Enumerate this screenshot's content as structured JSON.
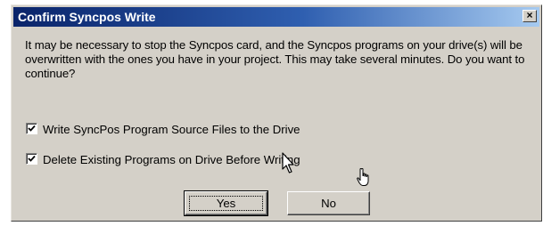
{
  "window": {
    "title": "Confirm Syncpos Write",
    "close_label": "×"
  },
  "message": "It may be necessary to stop the Syncpos card, and the Syncpos programs on your drive(s) will be overwritten with the ones you have in your project.  This may take several minutes.  Do you want to continue?",
  "options": [
    {
      "label": "Write SyncPos Program Source Files to the Drive",
      "checked": true
    },
    {
      "label": "Delete Existing Programs on Drive Before Writing",
      "checked": true
    }
  ],
  "buttons": {
    "yes_label": "Yes",
    "no_label": "No"
  },
  "colors": {
    "dialog_face": "#d4d0c8",
    "titlebar_start": "#0a246a",
    "titlebar_end": "#a6caf0"
  },
  "icons": [
    "close-icon",
    "checkmark-icon",
    "arrow-cursor-icon",
    "hand-cursor-icon"
  ]
}
